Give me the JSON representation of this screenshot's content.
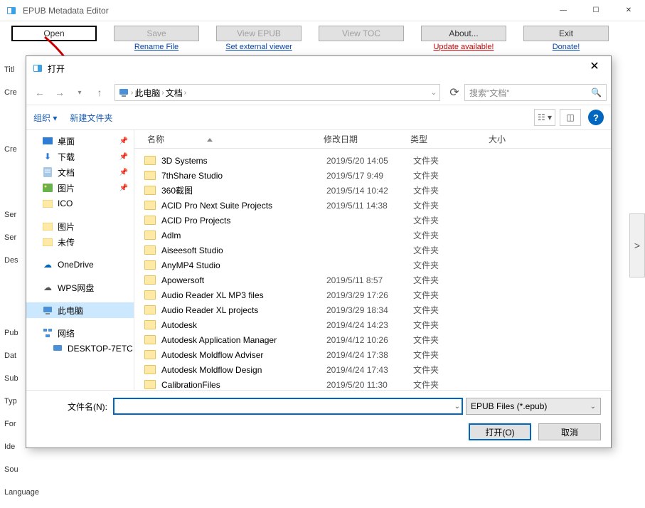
{
  "app": {
    "title": "EPUB Metadata Editor"
  },
  "win_controls": {
    "min": "—",
    "max": "☐",
    "close": "✕"
  },
  "toolbar": {
    "open": "Open",
    "save": "Save",
    "view_epub": "View EPUB",
    "view_toc": "View TOC",
    "about": "About...",
    "exit": "Exit",
    "rename": "Rename File",
    "set_viewer": "Set external viewer",
    "update": "Update available!",
    "donate": "Donate!"
  },
  "bg": [
    "Titl",
    "Cre",
    "Cre",
    "Ser",
    "Ser",
    "Des",
    "Pub",
    "Dat",
    "Sub",
    "Typ",
    "For",
    "Ide",
    "Sou",
    "Language"
  ],
  "dialog": {
    "title": "打开",
    "nav": {
      "this_pc": "此电脑",
      "docs": "文档"
    },
    "refresh": "⟳",
    "search_placeholder": "搜索\"文档\"",
    "cmd": {
      "organize": "组织 ▾",
      "new_folder": "新建文件夹"
    },
    "tree": {
      "desktop": "桌面",
      "downloads": "下载",
      "documents": "文档",
      "pictures": "图片",
      "ico": "ICO",
      "pictures2": "图片",
      "unsent": "未传",
      "onedrive": "OneDrive",
      "wps": "WPS网盘",
      "this_pc": "此电脑",
      "network": "网络",
      "desktop_pc": "DESKTOP-7ETC"
    },
    "columns": {
      "name": "名称",
      "date": "修改日期",
      "type": "类型",
      "size": "大小"
    },
    "rows": [
      {
        "n": "3D Systems",
        "d": "2019/5/20 14:05",
        "t": "文件夹"
      },
      {
        "n": "7thShare Studio",
        "d": "2019/5/17 9:49",
        "t": "文件夹"
      },
      {
        "n": "360截图",
        "d": "2019/5/14 10:42",
        "t": "文件夹"
      },
      {
        "n": "ACID Pro Next Suite Projects",
        "d": "2019/5/11 14:38",
        "t": "文件夹"
      },
      {
        "n": "ACID Pro Projects",
        "d": "",
        "t": "文件夹"
      },
      {
        "n": "Adlm",
        "d": "",
        "t": "文件夹"
      },
      {
        "n": "Aiseesoft Studio",
        "d": "",
        "t": "文件夹"
      },
      {
        "n": "AnyMP4 Studio",
        "d": "",
        "t": "文件夹"
      },
      {
        "n": "Apowersoft",
        "d": "2019/5/11 8:57",
        "t": "文件夹"
      },
      {
        "n": "Audio Reader XL MP3 files",
        "d": "2019/3/29 17:26",
        "t": "文件夹"
      },
      {
        "n": "Audio Reader XL projects",
        "d": "2019/3/29 18:34",
        "t": "文件夹"
      },
      {
        "n": "Autodesk",
        "d": "2019/4/24 14:23",
        "t": "文件夹"
      },
      {
        "n": "Autodesk Application Manager",
        "d": "2019/4/12 10:26",
        "t": "文件夹"
      },
      {
        "n": "Autodesk Moldflow Adviser",
        "d": "2019/4/24 17:38",
        "t": "文件夹"
      },
      {
        "n": "Autodesk Moldflow Design",
        "d": "2019/4/24 17:43",
        "t": "文件夹"
      },
      {
        "n": "CalibrationFiles",
        "d": "2019/5/20 11:30",
        "t": "文件夹"
      }
    ],
    "filename_label": "文件名(N):",
    "filetype": "EPUB Files (*.epub)",
    "open_btn": "打开(O)",
    "cancel_btn": "取消"
  }
}
